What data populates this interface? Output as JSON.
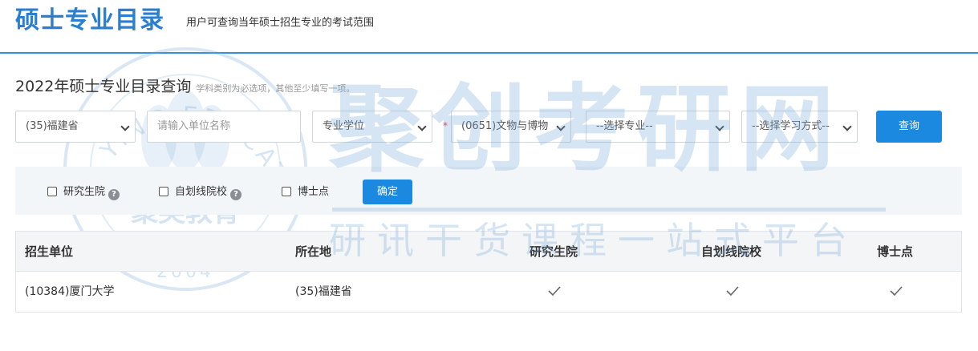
{
  "header": {
    "title": "硕士专业目录",
    "subtitle": "用户可查询当年硕士招生专业的考试范围"
  },
  "query": {
    "title": "2022年硕士专业目录查询",
    "hint": "学科类别为必选项，其他至少填写一项。",
    "province_select": "(35)福建省",
    "unit_input_placeholder": "请输入单位名称",
    "degree_type_select": "专业学位",
    "required_mark": "*",
    "discipline_select": "(0651)文物与博物",
    "major_select": "--选择专业--",
    "study_mode_select": "--选择学习方式--",
    "query_button": "查询"
  },
  "filters": {
    "graduate_school_label": "研究生院",
    "self_line_label": "自划线院校",
    "doctoral_label": "博士点",
    "help_mark": "?",
    "confirm_button": "确定",
    "graduate_school_checked": false,
    "self_line_checked": false,
    "doctoral_checked": false
  },
  "table": {
    "headers": [
      "招生单位",
      "所在地",
      "研究生院",
      "自划线院校",
      "博士点"
    ],
    "rows": [
      {
        "unit": "(10384)厦门大学",
        "location": "(35)福建省",
        "graduate_school": true,
        "self_line": true,
        "doctoral": true
      }
    ]
  },
  "watermark": {
    "big_text": "聚创考研网",
    "small_text": "研讯干货课程一站式平台",
    "seal_text": "聚英教育",
    "seal_ring_text": "JU YING EDUCATION",
    "seal_year": "2004"
  },
  "colors": {
    "brand_blue": "#2b7fd1",
    "button_blue": "#1b89e0",
    "required_red": "#e33333",
    "watermark_blue": "#78aad7"
  }
}
